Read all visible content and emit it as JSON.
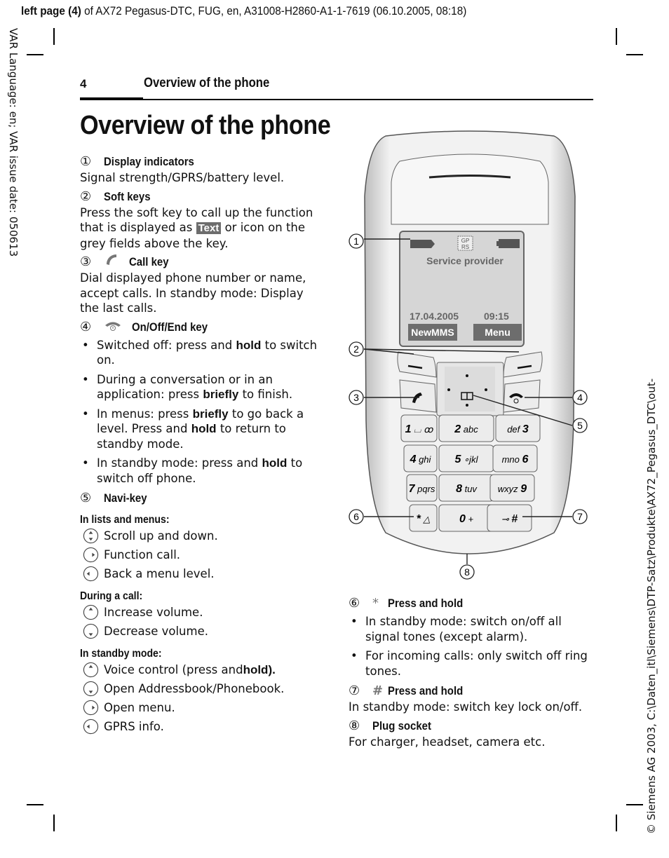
{
  "slug": {
    "bold_part": "left page (4)",
    "rest": " of AX72 Pegasus-DTC, FUG, en, A31008-H2860-A1-1-7619 (06.10.2005, 08:18)"
  },
  "margin_left_text": "VAR Language: en; VAR issue date: 050613",
  "margin_right_text": "© Siemens AG 2003, C:\\Daten_itl\\Siemens\\DTP-Satz\\Produkte\\AX72_Pegasus_DTC\\out-",
  "running_head": {
    "page_number": "4",
    "title": "Overview of the phone"
  },
  "page_title": "Overview of the phone",
  "sections": {
    "s1": {
      "num": "①",
      "title": "Display indicators",
      "text": "Signal strength/GPRS/battery level."
    },
    "s2": {
      "num": "②",
      "title": "Soft keys",
      "text_before": "Press the soft key to call up the function that is displayed as ",
      "badge": "Text",
      "text_after": " or icon on the grey fields above the key."
    },
    "s3": {
      "num": "③",
      "icon": "call-key-icon",
      "title": "Call key",
      "text": "Dial displayed phone number or name, accept calls. In standby mode: Display the last calls."
    },
    "s4": {
      "num": "④",
      "icon": "end-key-icon",
      "title": "On/Off/End key",
      "bullets": [
        {
          "a": "Switched off: press and ",
          "b": "hold",
          "c": " to switch on."
        },
        {
          "a": "During a conversation or in an application: press ",
          "b": "briefly",
          "c": " to finish."
        },
        {
          "a": "In menus: press ",
          "b": "briefly",
          "c": " to go back a level. Press and ",
          "d": "hold",
          "e": " to return to standby mode."
        },
        {
          "a": "In standby mode: press and ",
          "b": "hold",
          "c": " to switch off phone."
        }
      ]
    },
    "s5": {
      "num": "⑤",
      "title": "Navi-key",
      "groups": [
        {
          "label": "In lists and menus:",
          "items": [
            {
              "icon": "up-down",
              "text": "Scroll up and down."
            },
            {
              "icon": "right",
              "text": "Function call."
            },
            {
              "icon": "left",
              "text": "Back a menu level."
            }
          ]
        },
        {
          "label": "During a call:",
          "items": [
            {
              "icon": "up",
              "text": "Increase volume."
            },
            {
              "icon": "down",
              "text": "Decrease volume."
            }
          ]
        },
        {
          "label": "In standby mode:",
          "items": [
            {
              "icon": "up",
              "text": "Voice control (press and ",
              "bold": "hold)."
            },
            {
              "icon": "down",
              "text": "Open Addressbook/Phonebook."
            },
            {
              "icon": "right",
              "text": "Open menu."
            },
            {
              "icon": "left",
              "text": "GPRS info."
            }
          ]
        }
      ]
    },
    "s6": {
      "num": "⑥",
      "icon_glyph": "*",
      "title": "Press and hold",
      "bullets": [
        "In standby mode: switch on/off all signal tones (except alarm).",
        "For incoming calls: only switch off ring tones."
      ]
    },
    "s7": {
      "num": "⑦",
      "icon_glyph": "#",
      "title": "Press and hold",
      "text": "In standby mode: switch key lock on/off."
    },
    "s8": {
      "num": "⑧",
      "title": "Plug socket",
      "text": "For charger, headset, camera etc."
    }
  },
  "phone": {
    "screen": {
      "gprs_line1": "GP",
      "gprs_line2": "RS",
      "provider": "Service provider",
      "date": "17.04.2005",
      "time": "09:15",
      "softkey_left": "NewMMS",
      "softkey_right": "Menu"
    },
    "keys": [
      {
        "main": "1",
        "sub": "⌴ ꝏ"
      },
      {
        "main": "2",
        "sub": "abc"
      },
      {
        "main": "3",
        "sub": "def"
      },
      {
        "main": "4",
        "sub": "ghi"
      },
      {
        "main": "5",
        "sub": "∘jkl"
      },
      {
        "main": "6",
        "sub": "mno"
      },
      {
        "main": "7",
        "sub": "pqrs"
      },
      {
        "main": "8",
        "sub": "tuv"
      },
      {
        "main": "9",
        "sub": "wxyz"
      },
      {
        "main": "*",
        "sub": "△"
      },
      {
        "main": "0",
        "sub": "+"
      },
      {
        "main": "#",
        "sub": "⊸"
      }
    ],
    "callouts": [
      "1",
      "2",
      "3",
      "4",
      "5",
      "6",
      "7",
      "8"
    ]
  }
}
